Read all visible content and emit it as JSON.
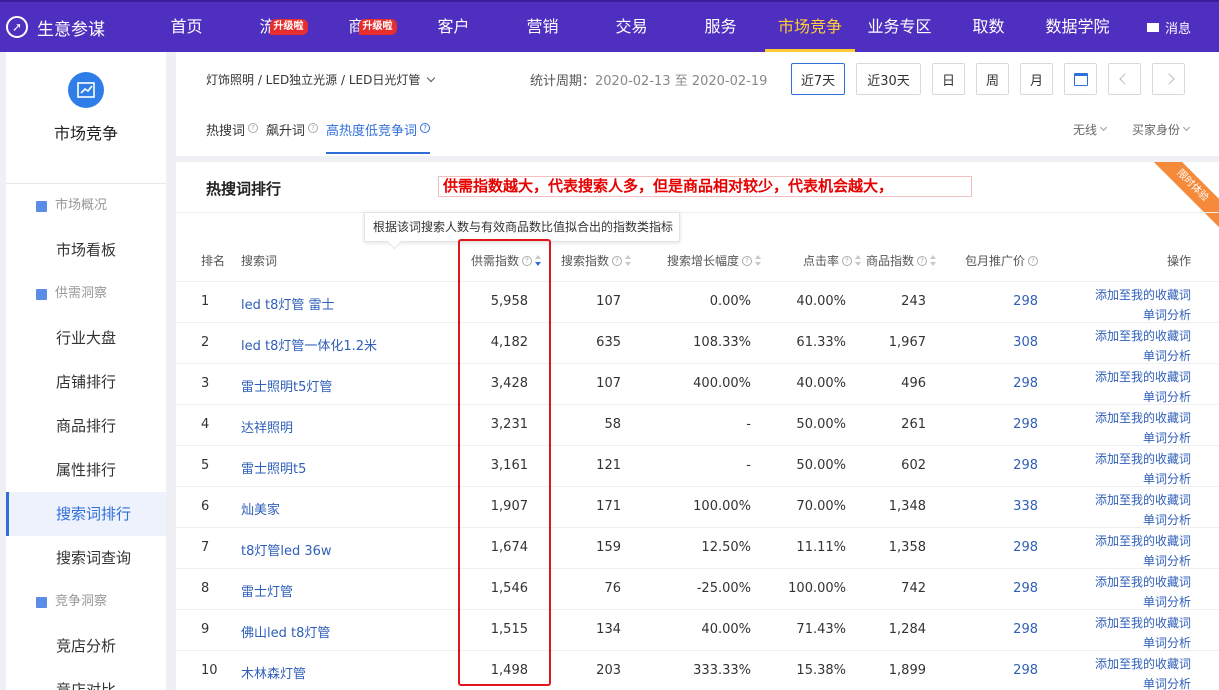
{
  "logo": {
    "text": "生意参谋"
  },
  "nav": {
    "items": [
      {
        "label": "首页",
        "badge": ""
      },
      {
        "label": "流量",
        "badge": "升级啦"
      },
      {
        "label": "商品",
        "badge": "升级啦"
      },
      {
        "label": "客户",
        "badge": ""
      },
      {
        "label": "营销",
        "badge": ""
      },
      {
        "label": "交易",
        "badge": ""
      },
      {
        "label": "服务",
        "badge": ""
      },
      {
        "label": "市场竞争",
        "badge": ""
      },
      {
        "label": "业务专区",
        "badge": ""
      },
      {
        "label": "取数",
        "badge": ""
      },
      {
        "label": "数据学院",
        "badge": ""
      }
    ],
    "message": "消息"
  },
  "sidebar": {
    "title": "市场竞争",
    "groups": [
      {
        "label": "市场概况",
        "items": [
          "市场看板"
        ]
      },
      {
        "label": "供需洞察",
        "items": [
          "行业大盘",
          "店铺排行",
          "商品排行",
          "属性排行",
          "搜索词排行",
          "搜索词查询"
        ]
      },
      {
        "label": "竞争洞察",
        "items": [
          "竞店分析",
          "竞店对比"
        ]
      }
    ]
  },
  "toolbar": {
    "breadcrumb": "灯饰照明 / LED独立光源 / LED日光灯管",
    "period_label": "统计周期：",
    "period_value": "2020-02-13 至 2020-02-19",
    "btn_7d": "近7天",
    "btn_30d": "近30天",
    "btn_day": "日",
    "btn_week": "周",
    "btn_month": "月"
  },
  "subtabs": [
    "热搜词",
    "飙升词",
    "高热度低竞争词"
  ],
  "filters": [
    "无线",
    "买家身份"
  ],
  "panel": {
    "title": "热搜词排行",
    "annotation": "供需指数越大，代表搜索人多，但是商品相对较少，代表机会越大，",
    "ribbon": "限时体验",
    "tooltip": "根据该词搜索人数与有效商品数比值拟合出的指数类指标"
  },
  "table": {
    "headers": [
      "排名",
      "搜索词",
      "供需指数",
      "搜索指数",
      "搜索增长幅度",
      "点击率",
      "商品指数",
      "包月推广价",
      "操作"
    ],
    "op_add": "添加至我的收藏词",
    "op_analyze": "单词分析",
    "rows": [
      {
        "rank": "1",
        "keyword": "led t8灯管 雷士",
        "supply": "5,958",
        "search": "107",
        "growth": "0.00%",
        "ctr": "40.00%",
        "goods": "243",
        "price": "298"
      },
      {
        "rank": "2",
        "keyword": "led t8灯管一体化1.2米",
        "supply": "4,182",
        "search": "635",
        "growth": "108.33%",
        "ctr": "61.33%",
        "goods": "1,967",
        "price": "308"
      },
      {
        "rank": "3",
        "keyword": "雷士照明t5灯管",
        "supply": "3,428",
        "search": "107",
        "growth": "400.00%",
        "ctr": "40.00%",
        "goods": "496",
        "price": "298"
      },
      {
        "rank": "4",
        "keyword": "达祥照明",
        "supply": "3,231",
        "search": "58",
        "growth": "-",
        "ctr": "50.00%",
        "goods": "261",
        "price": "298"
      },
      {
        "rank": "5",
        "keyword": "雷士照明t5",
        "supply": "3,161",
        "search": "121",
        "growth": "-",
        "ctr": "50.00%",
        "goods": "602",
        "price": "298"
      },
      {
        "rank": "6",
        "keyword": "灿美家",
        "supply": "1,907",
        "search": "171",
        "growth": "100.00%",
        "ctr": "70.00%",
        "goods": "1,348",
        "price": "338"
      },
      {
        "rank": "7",
        "keyword": "t8灯管led 36w",
        "supply": "1,674",
        "search": "159",
        "growth": "12.50%",
        "ctr": "11.11%",
        "goods": "1,358",
        "price": "298"
      },
      {
        "rank": "8",
        "keyword": "雷士灯管",
        "supply": "1,546",
        "search": "76",
        "growth": "-25.00%",
        "ctr": "100.00%",
        "goods": "742",
        "price": "298"
      },
      {
        "rank": "9",
        "keyword": "佛山led t8灯管",
        "supply": "1,515",
        "search": "134",
        "growth": "40.00%",
        "ctr": "71.43%",
        "goods": "1,284",
        "price": "298"
      },
      {
        "rank": "10",
        "keyword": "木林森灯管",
        "supply": "1,498",
        "search": "203",
        "growth": "333.33%",
        "ctr": "15.38%",
        "goods": "1,899",
        "price": "298"
      }
    ]
  },
  "colors": {
    "nav_bg": "#4f2fbf",
    "accent": "#2f6fd8",
    "active_nav": "#ffcc33",
    "highlight": "#e0161b"
  }
}
